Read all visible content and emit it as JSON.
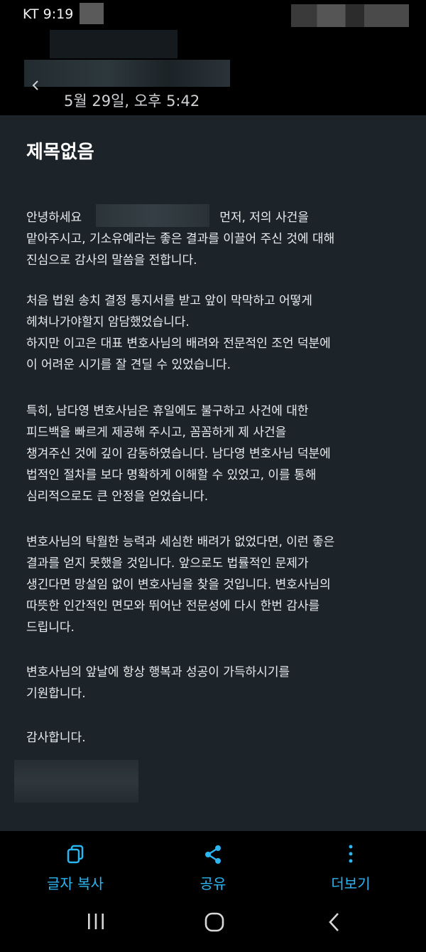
{
  "status_bar": {
    "carrier_time": "KT 9:19"
  },
  "header": {
    "date": "5월 29일, 오후 5:42"
  },
  "message": {
    "title": "제목없음",
    "paragraphs": [
      {
        "lines": [
          "안녕하세요",
          "맡아주시고, 기소유예라는 좋은 결과를 이끌어 주신 것에 대해",
          "진심으로 감사의 말씀을 전합니다."
        ],
        "first_line_suffix": "먼저, 저의 사건을"
      },
      {
        "lines": [
          "처음 법원 송치 결정 통지서를 받고 앞이 막막하고 어떻게",
          "헤쳐나가야할지 암담했었습니다.",
          "하지만 이고은 대표 변호사님의 배려와 전문적인 조언 덕분에",
          "이 어려운 시기를 잘 견딜 수 있었습니다."
        ]
      },
      {
        "lines": [
          "특히, 남다영 변호사님은 휴일에도 불구하고 사건에 대한",
          "피드백을 빠르게 제공해 주시고, 꼼꼼하게 제 사건을",
          "챙겨주신 것에 깊이 감동하였습니다. 남다영 변호사님 덕분에",
          "법적인 절차를 보다 명확하게 이해할 수 있었고, 이를 통해",
          "심리적으로도 큰 안정을 얻었습니다."
        ]
      },
      {
        "lines": [
          "변호사님의 탁월한 능력과 세심한 배려가 없었다면, 이런 좋은",
          "결과를 얻지 못했을 것입니다. 앞으로도 법률적인 문제가",
          "생긴다면 망설임 없이 변호사님을 찾을 것입니다. 변호사님의",
          "따뜻한 인간적인 면모와 뛰어난 전문성에 다시 한번 감사를",
          "드립니다."
        ]
      },
      {
        "lines": [
          "변호사님의 앞날에 항상 행복과 성공이 가득하시기를",
          "기원합니다."
        ]
      },
      {
        "lines": [
          "감사합니다."
        ]
      }
    ]
  },
  "actions": {
    "copy_label": "글자 복사",
    "share_label": "공유",
    "more_label": "더보기"
  },
  "icons": {
    "copy": "copy-icon",
    "share": "share-icon",
    "more": "more-vertical-icon",
    "recent": "recent-apps-icon",
    "home": "home-icon",
    "back": "back-icon"
  },
  "colors": {
    "accent": "#2bb6f1",
    "content_bg": "#1d2429",
    "background": "#000000"
  }
}
